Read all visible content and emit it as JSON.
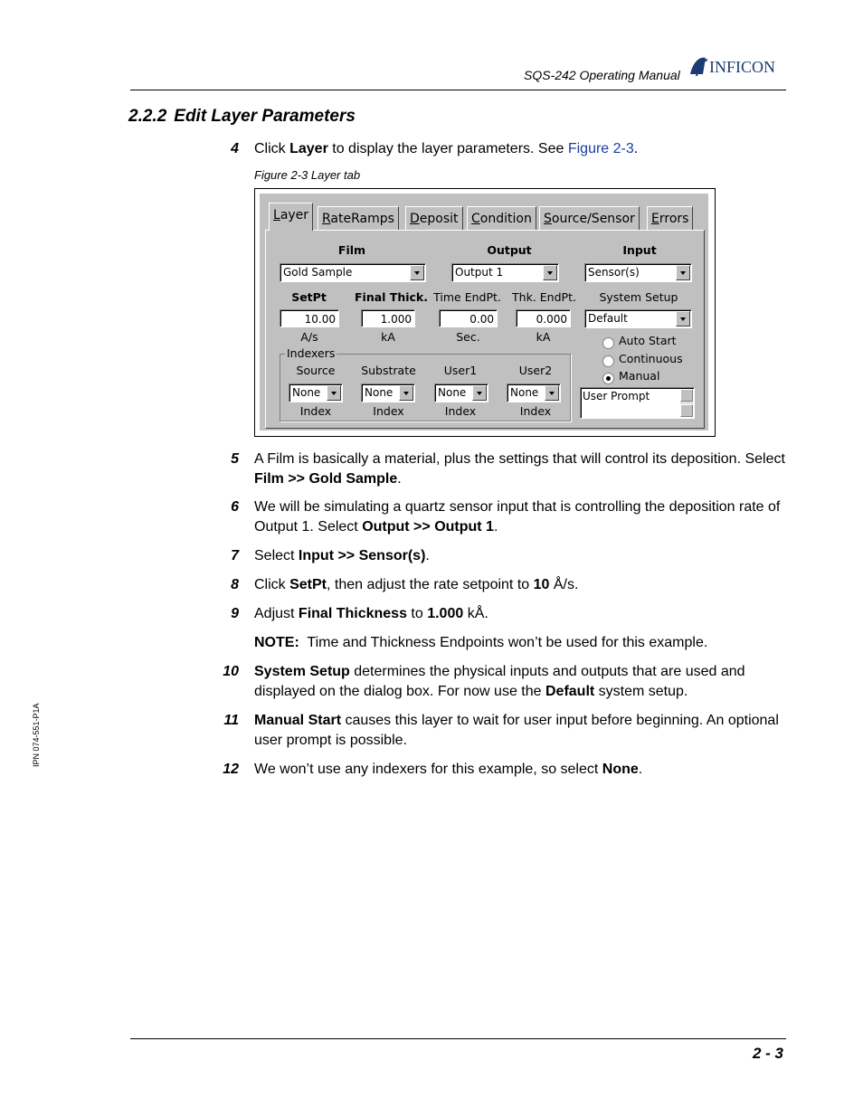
{
  "header": {
    "title": "SQS-242 Operating Manual",
    "brand": "INFICON"
  },
  "section": {
    "number": "2.2.2",
    "title": "Edit Layer Parameters"
  },
  "steps": {
    "s4": {
      "num": "4",
      "pre": "Click ",
      "b1": "Layer",
      "mid": " to display the layer parameters. See ",
      "link": "Figure 2-3",
      "post": "."
    },
    "s5": {
      "num": "5",
      "pre": "A Film is basically a material, plus the settings that will control its deposition. Select ",
      "b1": "Film >> Gold Sample",
      "post": "."
    },
    "s6": {
      "num": "6",
      "pre": "We will be simulating a quartz sensor input that is controlling the deposition rate of Output 1. Select ",
      "b1": "Output >> Output 1",
      "post": "."
    },
    "s7": {
      "num": "7",
      "pre": "Select ",
      "b1": "Input >> Sensor(s)",
      "post": "."
    },
    "s8": {
      "num": "8",
      "pre": "Click ",
      "b1": "SetPt",
      "mid": ", then adjust the rate setpoint to ",
      "b2": "10",
      "post": " Å/s."
    },
    "s9": {
      "num": "9",
      "pre": "Adjust ",
      "b1": "Final Thickness",
      "mid": " to ",
      "b2": "1.000",
      "post": " kÅ."
    },
    "note": {
      "label": "NOTE:",
      "text": "  Time and Thickness Endpoints won’t be used for this example."
    },
    "s10": {
      "num": "10",
      "b1": "System Setup",
      "mid": " determines the physical inputs and outputs that are used and displayed on the dialog box. For now use the ",
      "b2": "Default",
      "post": " system setup."
    },
    "s11": {
      "num": "11",
      "b1": "Manual Start",
      "post": " causes this layer to wait for user input before beginning. An optional user prompt is possible."
    },
    "s12": {
      "num": "12",
      "pre": "We won’t use any indexers for this example, so select ",
      "b1": "None",
      "post": "."
    }
  },
  "figure": {
    "caption": "Figure 2-3  Layer tab",
    "tabs": [
      "Layer",
      "RateRamps",
      "Deposit",
      "Condition",
      "Source/Sensor",
      "Errors"
    ],
    "labels": {
      "film": "Film",
      "output": "Output",
      "input": "Input",
      "setpt": "SetPt",
      "final_thick": "Final Thick.",
      "time_endpt": "Time EndPt.",
      "thk_endpt": "Thk. EndPt.",
      "system_setup": "System Setup",
      "unit_rate": "A/s",
      "unit_ka1": "kA",
      "unit_sec": "Sec.",
      "unit_ka2": "kA",
      "indexers": "Indexers",
      "source": "Source",
      "substrate": "Substrate",
      "user1": "User1",
      "user2": "User2",
      "index1": "Index",
      "index2": "Index",
      "index3": "Index",
      "index4": "Index"
    },
    "values": {
      "film": "Gold Sample",
      "output": "Output 1",
      "input": "Sensor(s)",
      "system_setup": "Default",
      "setpt": "10.00",
      "final_thick": "1.000",
      "time_endpt": "0.00",
      "thk_endpt": "0.000",
      "idx_source": "None",
      "idx_substrate": "None",
      "idx_user1": "None",
      "idx_user2": "None",
      "user_prompt": "User Prompt"
    },
    "radios": {
      "auto": "Auto Start",
      "continuous": "Continuous",
      "manual": "Manual",
      "selected": "Manual"
    }
  },
  "footer": {
    "page": "2 - 3",
    "ipn": "IPN 074-551-P1A"
  },
  "colors": {
    "link": "#1a3ca6",
    "brand": "#1f3b73",
    "dialog_bg": "#c0c0c0"
  }
}
